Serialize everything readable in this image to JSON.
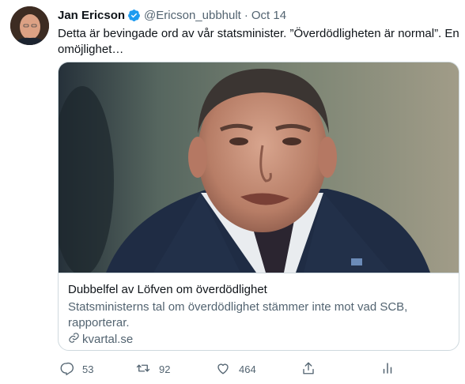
{
  "tweet": {
    "author_name": "Jan Ericson",
    "author_handle": "@Ericson_ubbhult",
    "separator": "·",
    "date": "Oct 14",
    "text": "Detta är bevingade ord av vår statsminister. ”Överdödligheten är normal”. En omöjlighet…"
  },
  "card": {
    "title": "Dubbelfel av Löfven om överdödlighet",
    "description": "Statsministerns tal om överdödlighet stämmer inte mot vad SCB, rapporterar.",
    "domain": "kvartal.se"
  },
  "actions": {
    "replies": "53",
    "retweets": "92",
    "likes": "464"
  },
  "colors": {
    "verified": "#1d9bf0",
    "muted": "#536471",
    "text": "#0f1419",
    "border": "#cfd9de"
  },
  "icons": [
    "verified-badge-icon",
    "link-icon",
    "reply-icon",
    "retweet-icon",
    "like-icon",
    "share-icon",
    "analytics-icon"
  ]
}
